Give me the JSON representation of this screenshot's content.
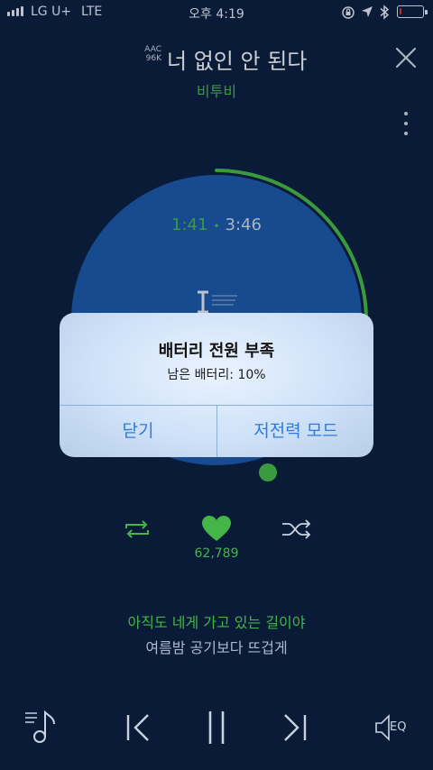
{
  "status_bar": {
    "carrier": "LG U+",
    "network": "LTE",
    "time": "오후 4:19",
    "battery_percent": 10
  },
  "player": {
    "audio_quality": [
      "AAC",
      "96K"
    ],
    "song_title": "너 없인 안 된다",
    "artist": "비투비",
    "time_current": "1:41",
    "time_separator": "•",
    "time_total": "3:46",
    "progress_fraction": 0.25,
    "like_count": "62,789",
    "lyric_current": "아직도 네게 가고 있는 길이야",
    "lyric_next": "여름밤 공기보다 뜨겁게",
    "eq_label": "EQ",
    "album_logo_letter": "T"
  },
  "alert": {
    "title": "배터리 전원 부족",
    "message": "남은 배터리: 10%",
    "buttons": {
      "close": "닫기",
      "low_power": "저전력 모드"
    }
  },
  "colors": {
    "background": "#0b2040",
    "accent_green": "#45b54a",
    "disc_blue": "#1c57a8",
    "alert_button_blue": "#2f7ae0",
    "battery_low": "#e53935"
  },
  "icons": [
    "signal-icon",
    "location-lock-icon",
    "location-arrow-icon",
    "bluetooth-icon",
    "battery-icon",
    "close-icon",
    "more-vertical-icon",
    "repeat-icon",
    "heart-icon",
    "shuffle-icon",
    "playlist-icon",
    "previous-icon",
    "pause-icon",
    "next-icon",
    "eq-icon"
  ]
}
